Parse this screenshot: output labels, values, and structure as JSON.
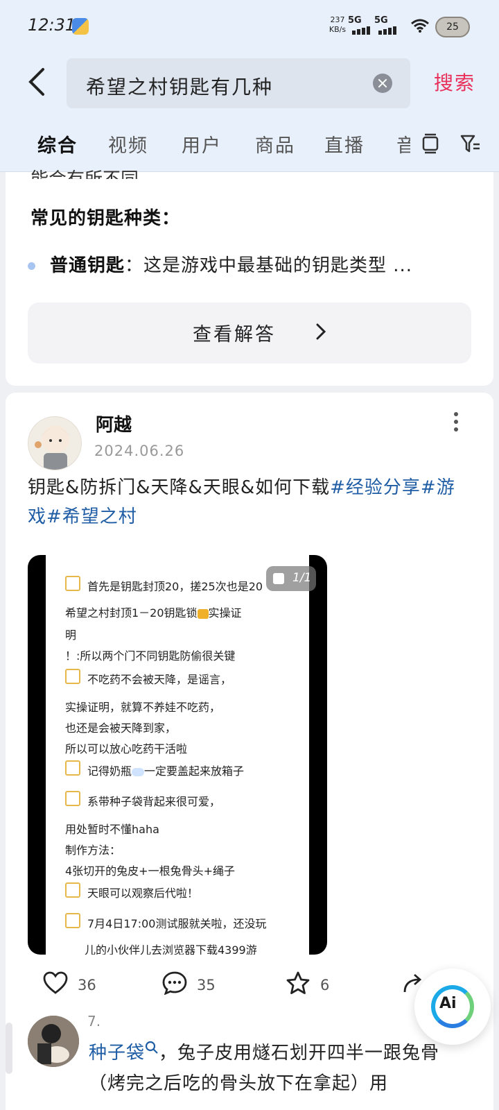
{
  "status_bar": {
    "time": "12:31",
    "net_speed_value": "237",
    "net_speed_unit": "KB/s",
    "signal_1": "5G",
    "signal_2": "5G",
    "battery": "25"
  },
  "search": {
    "query": "希望之村钥匙有几种",
    "submit_label": "搜索"
  },
  "tabs": [
    {
      "label": "综合",
      "active": true
    },
    {
      "label": "视频"
    },
    {
      "label": "用户"
    },
    {
      "label": "商品"
    },
    {
      "label": "直播"
    },
    {
      "label": "音"
    }
  ],
  "answer": {
    "truncated_text": "能会有所不同。",
    "heading": "常见的钥匙种类：",
    "bullet_bold": "普通钥匙",
    "bullet_text": "：这是游戏中最基础的钥匙类型 ...",
    "view_button": "查看解答"
  },
  "post": {
    "author": "阿越",
    "date": "2024.06.26",
    "text": "钥匙&防拆门&天降&天眼&如何下载",
    "hashtags": [
      "#经验分享",
      "#游戏",
      "#希望之村"
    ],
    "image_counter": "1/1",
    "note_lines": {
      "l1": "首先是钥匙封顶20，搓25次也是20",
      "l2": "希望之村封顶1－20钥匙锁",
      "l2b": "实操证",
      "l3": "明",
      "l4": "！:所以两个门不同钥匙防偷很关键",
      "l5": "不吃药不会被天降，是谣言，",
      "l6": "实操证明，就算不养娃不吃药，",
      "l7": "也还是会被天降到家，",
      "l8": "所以可以放心吃药干活啦",
      "l9a": "记得奶瓶",
      "l9b": "一定要盖起来放箱子",
      "l10": "系带种子袋背起来很可爱，",
      "l11": "用处暂时不懂haha",
      "l12": "制作方法：",
      "l13": "4张切开的兔皮+一根兔骨头+绳子",
      "l14": "天眼可以观察后代啦！",
      "l15": "7月4日17:00测试服就关啦，还没玩",
      "l16": "儿的小伙伴儿去浏览器下载4399游"
    },
    "likes": "36",
    "comments": "35",
    "favorites": "6"
  },
  "comment": {
    "index": "7.",
    "user": "种子袋",
    "text": "，兔子皮用燧石划开四半一跟兔骨（烤完之后吃的骨头放下在拿起）用"
  },
  "ai_button": "Ai"
}
